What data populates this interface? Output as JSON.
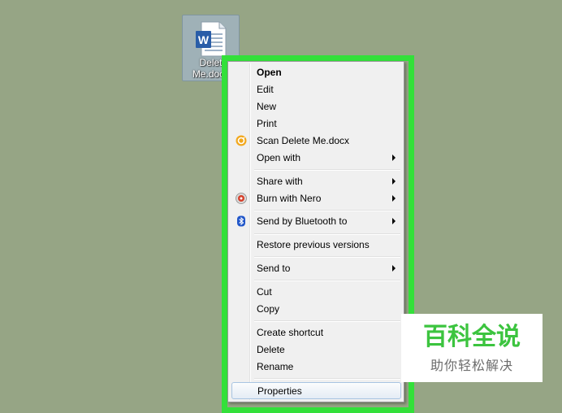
{
  "desktop": {
    "file_icon": {
      "icon": "word-document-icon",
      "label": "Delet\nMe.docx"
    }
  },
  "highlight": {
    "color": "#33e03a"
  },
  "context_menu": {
    "items": [
      {
        "label": "Open",
        "default": true
      },
      {
        "label": "Edit"
      },
      {
        "label": "New"
      },
      {
        "label": "Print"
      },
      {
        "label": "Scan Delete Me.docx",
        "icon": "antivirus-scan-icon"
      },
      {
        "label": "Open with",
        "submenu": true
      },
      {
        "label": "Share with",
        "submenu": true
      },
      {
        "label": "Burn with Nero",
        "icon": "nero-burn-icon",
        "submenu": true
      },
      {
        "label": "Send by Bluetooth to",
        "icon": "bluetooth-icon",
        "submenu": true
      },
      {
        "label": "Restore previous versions"
      },
      {
        "label": "Send to",
        "submenu": true
      },
      {
        "label": "Cut"
      },
      {
        "label": "Copy"
      },
      {
        "label": "Create shortcut"
      },
      {
        "label": "Delete"
      },
      {
        "label": "Rename"
      },
      {
        "label": "Properties",
        "highlighted": true
      }
    ]
  },
  "watermark": {
    "title": "百科全说",
    "subtitle": "助你轻松解决",
    "color": "#3cc43f"
  }
}
